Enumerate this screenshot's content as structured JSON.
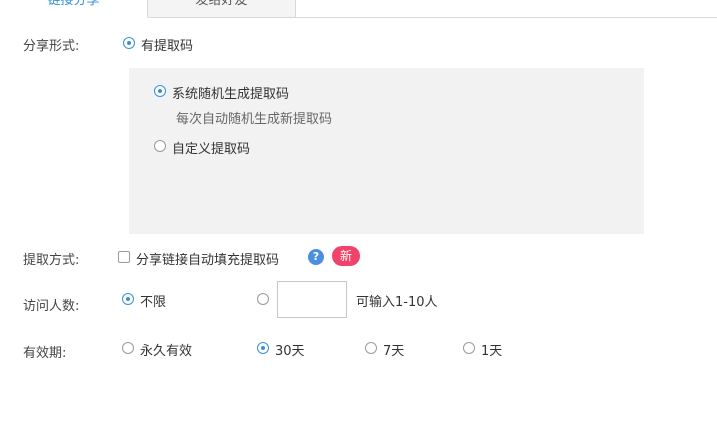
{
  "tabs": [
    {
      "label": "链接分享",
      "active": true
    },
    {
      "label": "发给好友",
      "active": false
    }
  ],
  "share_form": {
    "label": "分享形式:",
    "option_label": "有提取码",
    "sub_options": [
      {
        "label": "系统随机生成提取码",
        "hint": "每次自动随机生成新提取码",
        "checked": true
      },
      {
        "label": "自定义提取码",
        "checked": false
      }
    ]
  },
  "extract_method": {
    "label": "提取方式:",
    "checkbox_label": "分享链接自动填充提取码",
    "help_icon": "question-icon",
    "badge": "新",
    "badge_color": "#f0436a"
  },
  "visitors": {
    "label": "访问人数:",
    "unlimited_label": "不限",
    "input_value": "",
    "input_hint": "可输入1-10人"
  },
  "validity": {
    "label": "有效期:",
    "options": [
      {
        "label": "永久有效",
        "checked": false
      },
      {
        "label": "30天",
        "checked": true
      },
      {
        "label": "7天",
        "checked": false
      },
      {
        "label": "1天",
        "checked": false
      }
    ]
  },
  "colors": {
    "accent": "#3a8fd8",
    "panel_bg": "#f2f2f2"
  }
}
